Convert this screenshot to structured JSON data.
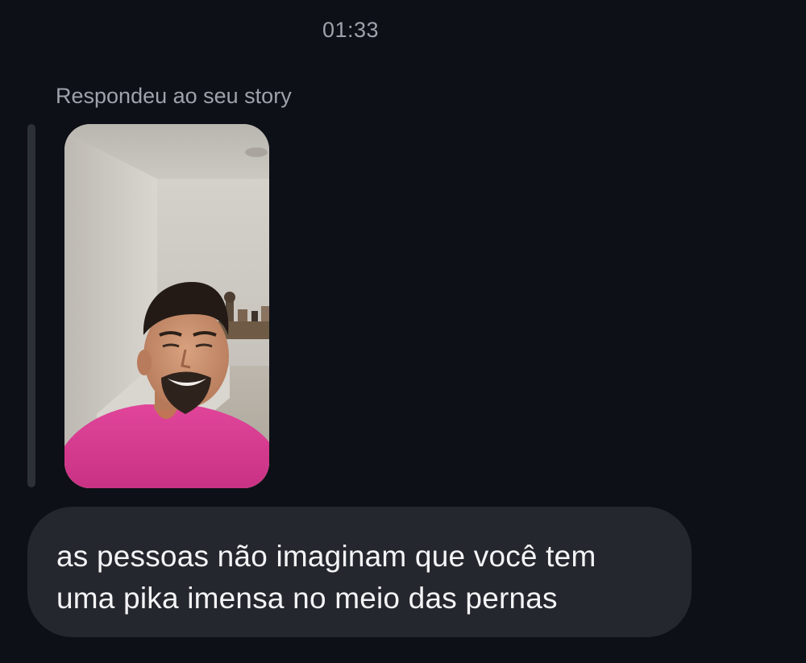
{
  "conversation": {
    "timestamp": "01:33",
    "reply_context": "Respondeu ao seu story",
    "story": {
      "thumbnail_icon": "story-photo-icon"
    },
    "message": {
      "lines": [
        "as pessoas não imaginam que você tem",
        "uma pika imensa no meio das pernas"
      ]
    }
  },
  "colors": {
    "background": "#0d1016",
    "bubble": "#24272d",
    "text": "#f3f4f6",
    "muted_text": "#9ea3ab",
    "reply_bar": "#2c3037"
  }
}
